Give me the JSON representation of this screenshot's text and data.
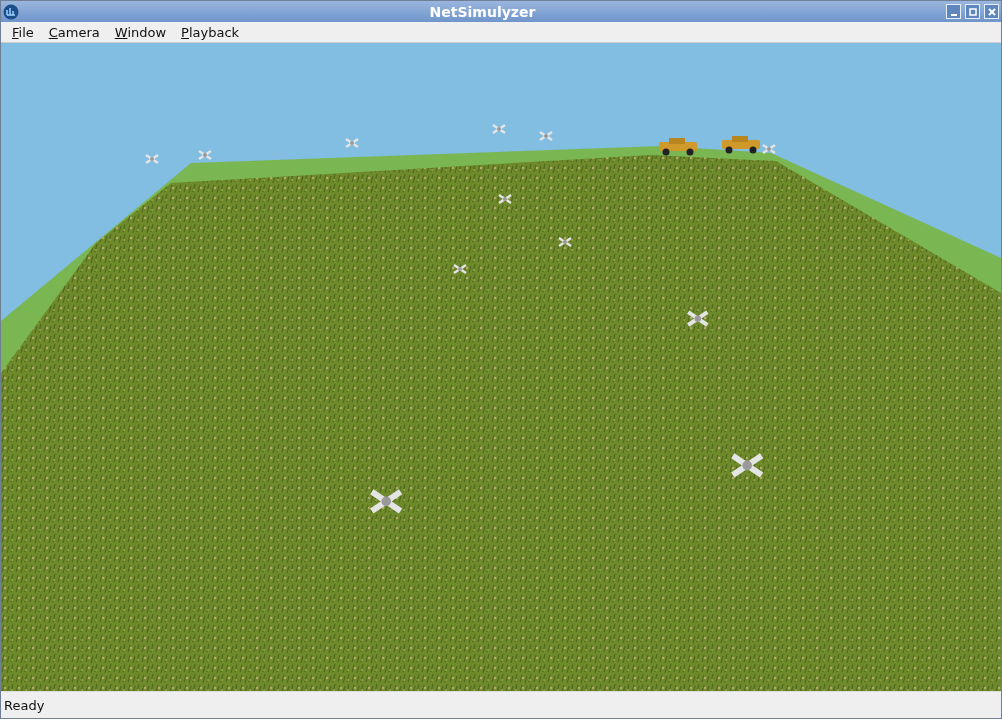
{
  "window": {
    "title": "NetSimulyzer"
  },
  "menu": [
    {
      "label": "File"
    },
    {
      "label": "Camera"
    },
    {
      "label": "Window"
    },
    {
      "label": "Playback"
    }
  ],
  "status_bar": {
    "text": "Ready"
  }
}
